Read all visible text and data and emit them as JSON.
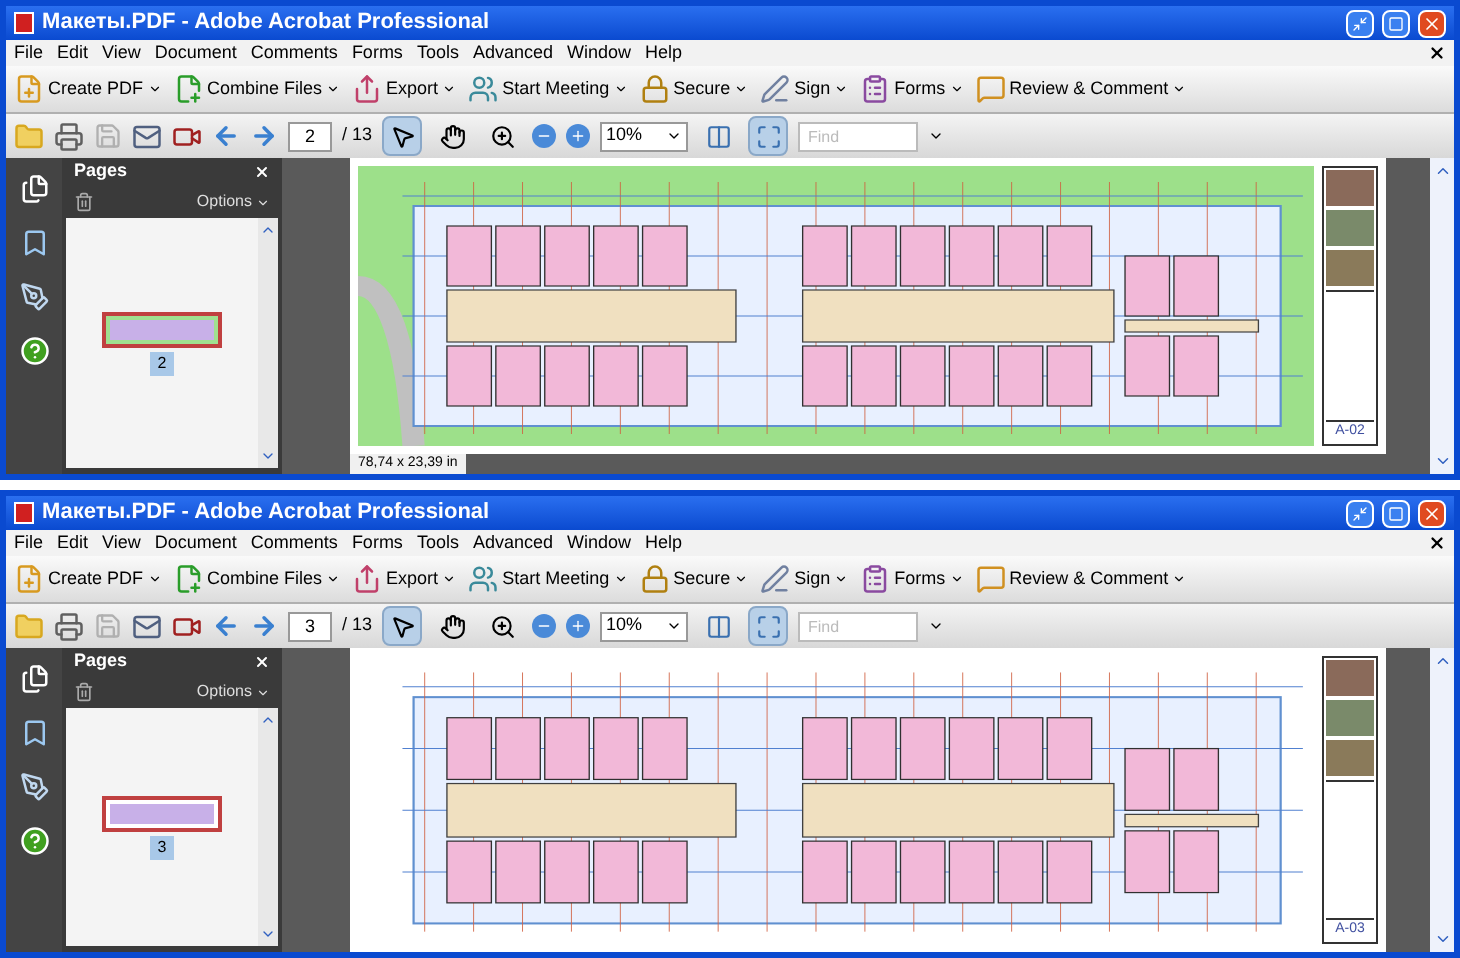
{
  "windows": [
    {
      "title": "Макеты.PDF - Adobe Acrobat Professional",
      "menu": [
        "File",
        "Edit",
        "View",
        "Document",
        "Comments",
        "Forms",
        "Tools",
        "Advanced",
        "Window",
        "Help"
      ],
      "tasks": [
        "Create PDF",
        "Combine Files",
        "Export",
        "Start Meeting",
        "Secure",
        "Sign",
        "Forms",
        "Review & Comment"
      ],
      "page": "2",
      "page_total": "/ 13",
      "view_tools": [
        {
          "selected": true
        },
        {
          "selected": false
        },
        {
          "selected": false
        }
      ],
      "zoom": "10%",
      "fit_buttons": [
        {
          "selected": false
        },
        {
          "selected": true
        }
      ],
      "find_placeholder": "Find",
      "panel": {
        "title": "Pages",
        "options": "Options",
        "thumbnail_label": "2"
      },
      "sheet_label": "A-02",
      "page_size": "78,74 x 23,39 in"
    },
    {
      "title": "Макеты.PDF - Adobe Acrobat Professional",
      "menu": [
        "File",
        "Edit",
        "View",
        "Document",
        "Comments",
        "Forms",
        "Tools",
        "Advanced",
        "Window",
        "Help"
      ],
      "tasks": [
        "Create PDF",
        "Combine Files",
        "Export",
        "Start Meeting",
        "Secure",
        "Sign",
        "Forms",
        "Review & Comment"
      ],
      "page": "3",
      "page_total": "/ 13",
      "view_tools": [
        {
          "selected": true
        },
        {
          "selected": false
        },
        {
          "selected": false
        }
      ],
      "zoom": "10%",
      "fit_buttons": [
        {
          "selected": false
        },
        {
          "selected": true
        }
      ],
      "find_placeholder": "Find",
      "panel": {
        "title": "Pages",
        "options": "Options",
        "thumbnail_label": "3"
      },
      "sheet_label": "A-03"
    }
  ]
}
